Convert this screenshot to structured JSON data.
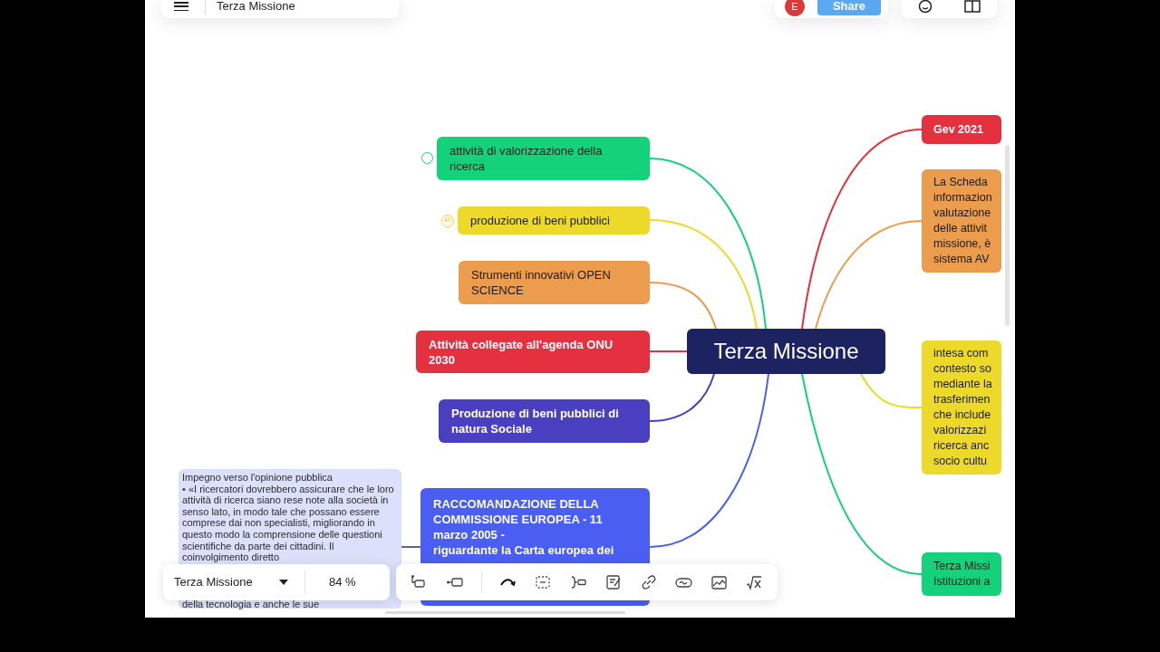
{
  "top_bar": {
    "title": "Terza Missione"
  },
  "collaboration": {
    "avatar": "E",
    "share_button": "Share"
  },
  "mind_map": {
    "central_topic": "Terza Missione",
    "left_topics": [
      {
        "text": "attività di valorizzazione della ricerca",
        "color": "#14d27a",
        "toggle": true
      },
      {
        "text": "produzione di beni pubblici",
        "color": "#ecd92a",
        "toggle": false,
        "badge": "40"
      },
      {
        "text": "Strumenti innovativi OPEN SCIENCE",
        "color": "#ec9c4d",
        "toggle": false
      },
      {
        "text": "Attività collegate all'agenda ONU 2030",
        "color": "#e5303f",
        "toggle": false
      },
      {
        "text": "Produzione di beni pubblici di natura Sociale",
        "color": "#4b3fc1",
        "toggle": false
      },
      {
        "text": "RACCOMANDAZIONE DELLA COMMISSIONE EUROPEA - 11 marzo 2005 -\nriguardante la Carta europea dei",
        "color": "#4a5ef2",
        "toggle": false
      }
    ],
    "note": {
      "text": "Impegno verso l'opinione pubblica\n• «I ricercatori dovrebbero assicurare che le loro attività di ricerca siano rese note alla società in senso lato, in modo tale che possano essere comprese dai non specialisti, migliorando in questo modo la comprensione delle questioni scientifiche da parte dei cittadini. Il coinvolgimento diretto",
      "tail": "della tecnologia e anche le sue"
    },
    "right_topics": [
      {
        "text": "Gev 2021",
        "color": "#e5303f"
      },
      {
        "text": "La Scheda\ninformazion\nvalutazione\ndelle attivit\nmissione, è\nsistema AV",
        "color": "#ec9c4d"
      },
      {
        "text": "intesa com\ncontesto so\nmediante la\ntrasferimen\nche include\nvalorizzazi\nricerca anc\nsocio cultu",
        "color": "#ecd92a"
      },
      {
        "text": "Terza Missi\nIstituzioni a",
        "color": "#14d27a"
      }
    ]
  },
  "bottom_bar": {
    "map_selector": "Terza Missione",
    "zoom": "84 %"
  }
}
